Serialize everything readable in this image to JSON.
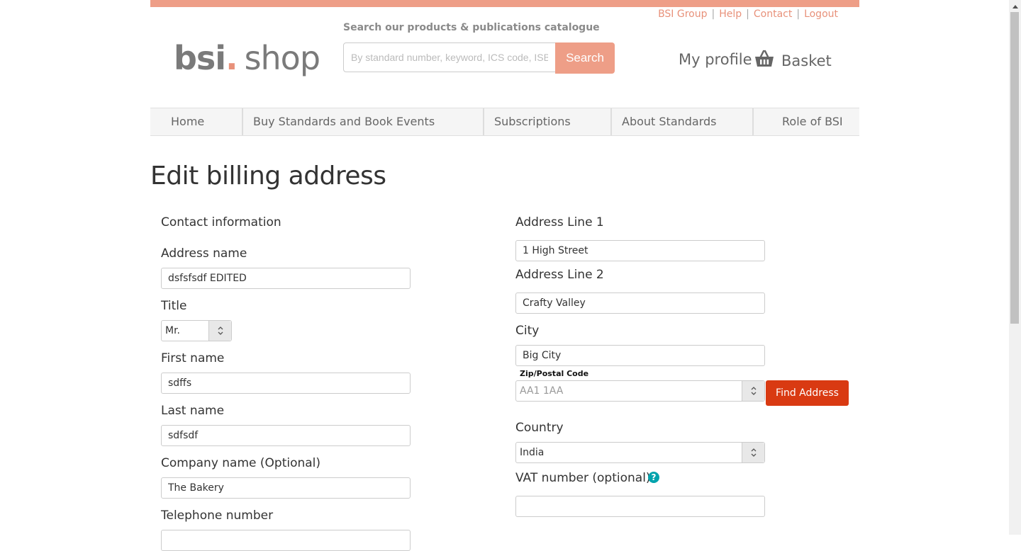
{
  "colors": {
    "accent": "#ee9e87",
    "accent_text": "#e8917a",
    "find_button": "#d93a12",
    "help_icon": "#00a3ad"
  },
  "utility_links": [
    "BSI Group",
    "Help",
    "Contact",
    "Logout"
  ],
  "logo": {
    "bsi": "bsi",
    "dot": ".",
    "shop": "shop"
  },
  "search": {
    "label": "Search our products & publications catalogue",
    "placeholder": "By standard number, keyword, ICS code, ISBN",
    "button": "Search"
  },
  "header": {
    "my_profile": "My profile",
    "basket": "Basket"
  },
  "nav": [
    "Home",
    "Buy Standards and Book Events",
    "Subscriptions",
    "About Standards",
    "Role of BSI"
  ],
  "page_title": "Edit billing address",
  "left": {
    "section": "Contact information",
    "address_name": {
      "label": "Address name",
      "value": "dsfsfsdf EDITED"
    },
    "title": {
      "label": "Title",
      "value": "Mr."
    },
    "first_name": {
      "label": "First name",
      "value": "sdffs"
    },
    "last_name": {
      "label": "Last name",
      "value": "sdfsdf"
    },
    "company": {
      "label": "Company name (Optional)",
      "value": "The Bakery"
    },
    "telephone": {
      "label": "Telephone number",
      "value": ""
    }
  },
  "right": {
    "address1": {
      "label": "Address Line 1",
      "value": "1 High Street"
    },
    "address2": {
      "label": "Address Line 2",
      "value": "Crafty Valley"
    },
    "city": {
      "label": "City",
      "value": "Big City"
    },
    "zip": {
      "label": "Zip/Postal Code",
      "placeholder": "AA1 1AA"
    },
    "find_button": "Find Address",
    "country": {
      "label": "Country",
      "value": "India"
    },
    "vat": {
      "label": "VAT number (optional)",
      "help": "?",
      "value": ""
    }
  }
}
